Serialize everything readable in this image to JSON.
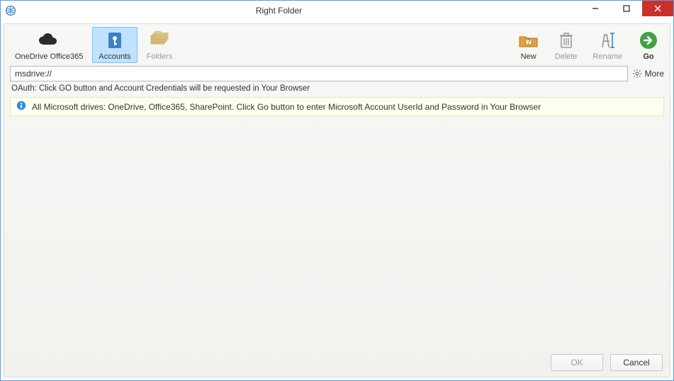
{
  "window": {
    "title": "Right Folder"
  },
  "toolbar": {
    "onedrive_label": "OneDrive Office365",
    "accounts_label": "Accounts",
    "folders_label": "Folders",
    "new_label": "New",
    "delete_label": "Delete",
    "rename_label": "Rename",
    "go_label": "Go"
  },
  "address": {
    "value": "msdrive://"
  },
  "more_label": "More",
  "hint": "OAuth: Click GO button and Account Credentials will be requested in Your Browser",
  "infobar": {
    "text": "All Microsoft drives: OneDrive, Office365, SharePoint. Click Go button to enter Microsoft Account UserId and Password in Your Browser"
  },
  "footer": {
    "ok": "OK",
    "cancel": "Cancel"
  }
}
